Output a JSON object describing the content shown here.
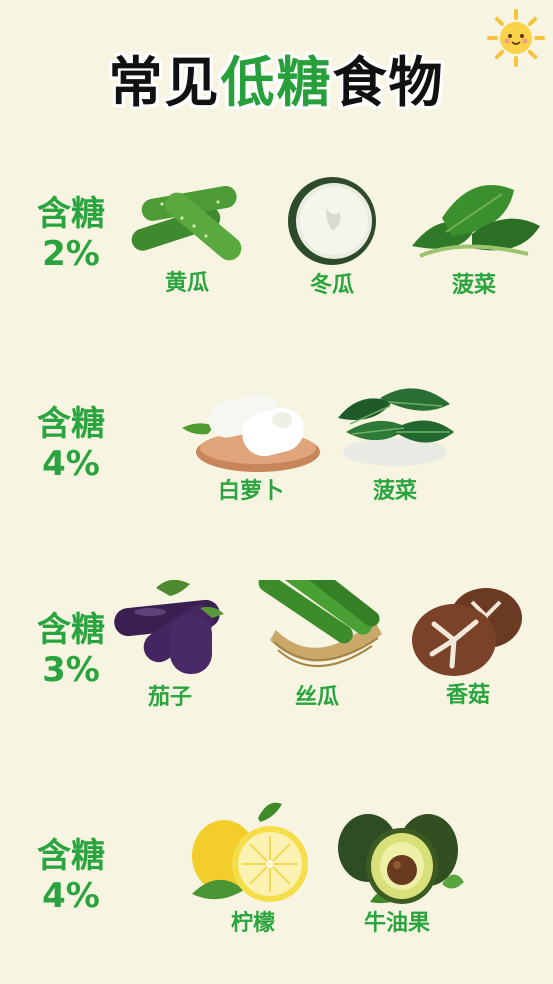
{
  "title": {
    "part1": "常见",
    "highlight": "低糖",
    "part2": "食物"
  },
  "rows": [
    {
      "sugar_label": "含糖",
      "sugar_value": "2%",
      "items": [
        {
          "name": "黄瓜",
          "icon": "cucumber-icon"
        },
        {
          "name": "冬瓜",
          "icon": "winter-melon-icon"
        },
        {
          "name": "菠菜",
          "icon": "spinach-icon"
        }
      ]
    },
    {
      "sugar_label": "含糖",
      "sugar_value": "4%",
      "items": [
        {
          "name": "白萝卜",
          "icon": "white-radish-icon"
        },
        {
          "name": "菠菜",
          "icon": "kelp-icon"
        }
      ]
    },
    {
      "sugar_label": "含糖",
      "sugar_value": "3%",
      "items": [
        {
          "name": "茄子",
          "icon": "eggplant-icon"
        },
        {
          "name": "丝瓜",
          "icon": "loofah-icon"
        },
        {
          "name": "香菇",
          "icon": "shiitake-icon"
        }
      ]
    },
    {
      "sugar_label": "含糖",
      "sugar_value": "4%",
      "items": [
        {
          "name": "柠檬",
          "icon": "lemon-icon"
        },
        {
          "name": "牛油果",
          "icon": "avocado-icon"
        }
      ]
    }
  ],
  "colors": {
    "background": "#f7f4e1",
    "accent_green": "#2aa43e",
    "title_black": "#111111"
  }
}
